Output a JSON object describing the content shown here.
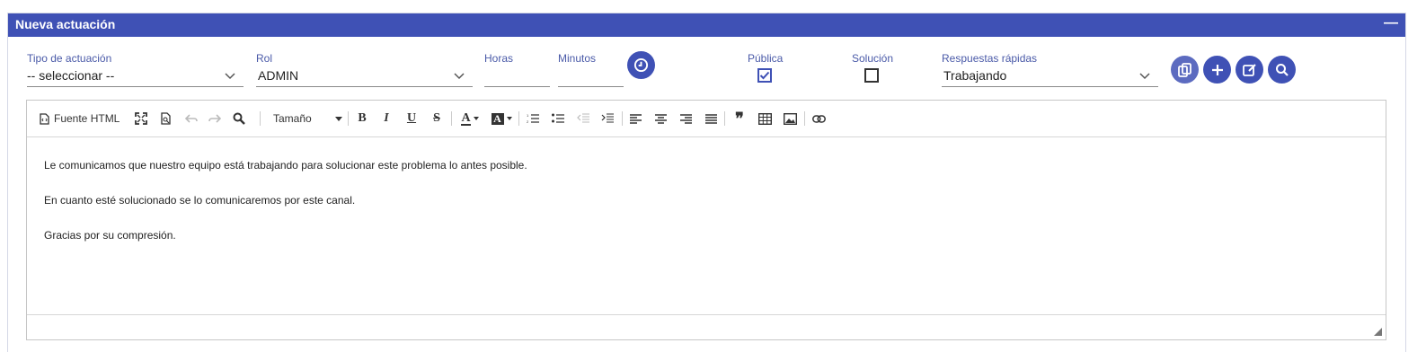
{
  "panel": {
    "title": "Nueva actuación",
    "collapse_label": "—"
  },
  "form": {
    "tipo": {
      "label": "Tipo de actuación",
      "value": "-- seleccionar --"
    },
    "rol": {
      "label": "Rol",
      "value": "ADMIN"
    },
    "horas": {
      "label": "Horas",
      "value": ""
    },
    "minutos": {
      "label": "Minutos",
      "value": ""
    },
    "publica": {
      "label": "Pública",
      "checked": true
    },
    "solucion": {
      "label": "Solución",
      "checked": false
    },
    "respuestas": {
      "label": "Respuestas rápidas",
      "value": "Trabajando"
    }
  },
  "actions": [
    "copy-icon",
    "plus-icon",
    "edit-icon",
    "search-icon"
  ],
  "toolbar": {
    "source_label": "Fuente HTML",
    "size_label": "Tamaño",
    "bold": "B",
    "italic": "I",
    "underline": "U",
    "strike": "S",
    "font_color": "A",
    "bg_color": "A",
    "blockquote": "❞"
  },
  "editor": {
    "lines": [
      "Le comunicamos que nuestro equipo está trabajando para solucionar este problema lo antes posible.",
      "En cuanto esté solucionado se lo comunicaremos por este canal.",
      "Gracias por su compresión."
    ]
  },
  "colors": {
    "primary": "#3f51b5",
    "label": "#4a5aa8"
  }
}
